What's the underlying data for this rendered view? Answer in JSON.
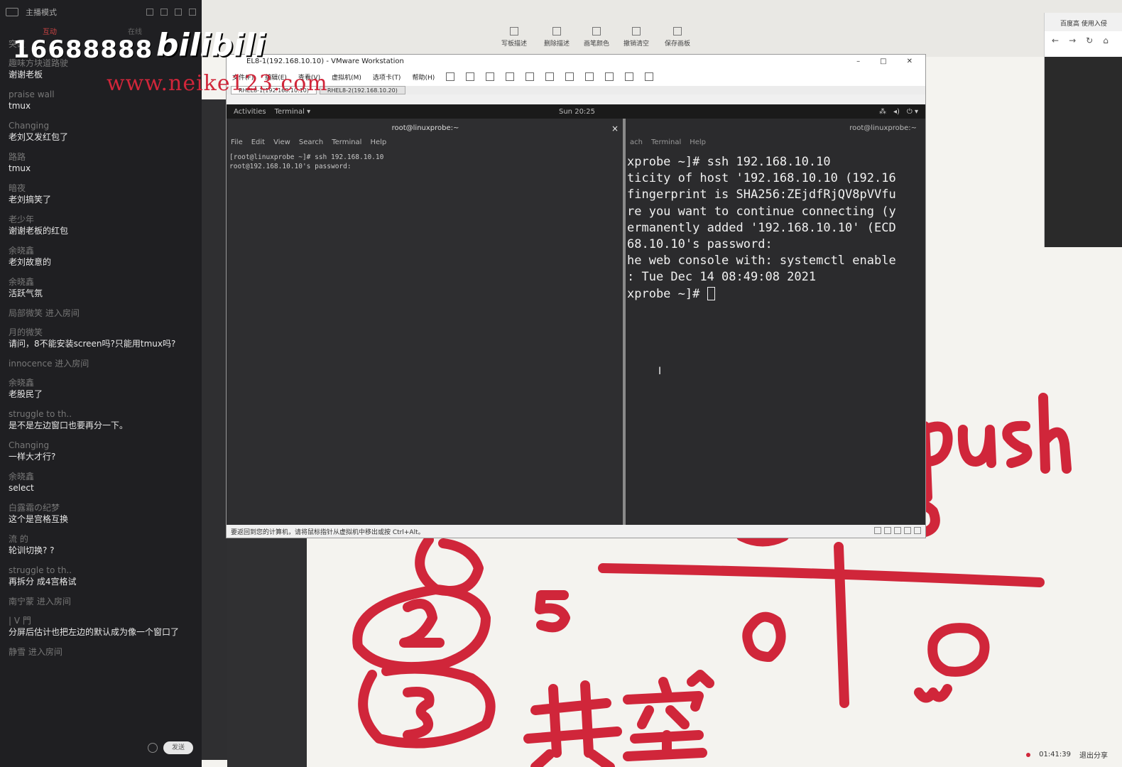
{
  "chat": {
    "header_label": "主播模式",
    "tabs": [
      "互动",
      "在线"
    ],
    "messages": [
      {
        "user": "突破",
        "text": ""
      },
      {
        "user": "趣味方块道路驶",
        "text": "谢谢老板"
      },
      {
        "user": "praise wall",
        "text": "tmux"
      },
      {
        "user": "Changing",
        "text": "老刘又发红包了"
      },
      {
        "user": "路路",
        "text": "tmux"
      },
      {
        "user": "暗夜",
        "text": "老刘搞笑了"
      },
      {
        "user": "老少年",
        "text": "谢谢老板的红包"
      },
      {
        "user": "余晓鑫",
        "text": "老刘故意的"
      },
      {
        "user": "余晓鑫",
        "text": "活跃气氛"
      },
      {
        "user": "局部微笑 进入房间",
        "text": ""
      },
      {
        "user": "月的微笑",
        "text": "请问，8不能安装screen吗?只能用tmux吗?"
      },
      {
        "user": "innocence 进入房间",
        "text": ""
      },
      {
        "user": "余晓鑫",
        "text": "老股民了"
      },
      {
        "user": "struggle to th..",
        "text": "是不是左边窗口也要再分一下。"
      },
      {
        "user": "Changing",
        "text": "一样大才行?"
      },
      {
        "user": "余晓鑫",
        "text": "select"
      },
      {
        "user": "白露霜の纪梦",
        "text": "这个是宫格互换"
      },
      {
        "user": "流 的",
        "text": "轮训切换? ?"
      },
      {
        "user": "struggle to th..",
        "text": "再拆分 成4宫格试"
      },
      {
        "user": "南宁蒙 进入房间",
        "text": ""
      },
      {
        "user": "| V 門",
        "text": "分屏后估计也把左边的默认成为像一个窗口了"
      },
      {
        "user": "静雪 进入房间",
        "text": ""
      }
    ],
    "send_label": "发送"
  },
  "watermark": {
    "number": "16688888",
    "logo": "bilibili",
    "url": "www.neike123.com"
  },
  "board": {
    "toolbar": [
      "写板描述",
      "删除描述",
      "画笔颜色",
      "撤销清空",
      "保存画板"
    ],
    "browser_tab": "百度高 使用入侵",
    "status_time": "01:41:39",
    "status_exit": "退出分享"
  },
  "vmware": {
    "title": "EL8-1(192.168.10.10) - VMware Workstation",
    "menu": [
      "文件(F)",
      "编辑(E)",
      "查看(V)",
      "虚拟机(M)",
      "选项卡(T)",
      "帮助(H)"
    ],
    "tabs": [
      "RHEL8-1(192.168.10.10)",
      "RHEL8-2(192.168.10.20)"
    ],
    "status_text": "要返回到您的计算机，请将鼠标指针从虚拟机中移出或按 Ctrl+Alt。"
  },
  "gnome": {
    "activities": "Activities",
    "app": "Terminal ▾",
    "clock": "Sun 20:25"
  },
  "term_left": {
    "title": "root@linuxprobe:~",
    "menu": [
      "File",
      "Edit",
      "View",
      "Search",
      "Terminal",
      "Help"
    ],
    "lines": [
      "[root@linuxprobe ~]# ssh 192.168.10.10",
      "root@192.168.10.10's password:"
    ]
  },
  "term_right": {
    "title": "root@linuxprobe:~",
    "menu": [
      "ach",
      "Terminal",
      "Help"
    ],
    "lines": [
      "xprobe ~]# ssh 192.168.10.10",
      "ticity of host '192.168.10.10 (192.16",
      "fingerprint is SHA256:ZEjdfRjQV8pVVfu",
      "re you want to continue connecting (y",
      "ermanently added '192.168.10.10' (ECD",
      "68.10.10's password:",
      "he web console with: systemctl enable",
      "",
      ": Tue Dec 14 08:49:08 2021"
    ],
    "prompt": "xprobe ~]# "
  },
  "handwriting": [
    "push",
    "2",
    "5",
    "3",
    "共空"
  ]
}
